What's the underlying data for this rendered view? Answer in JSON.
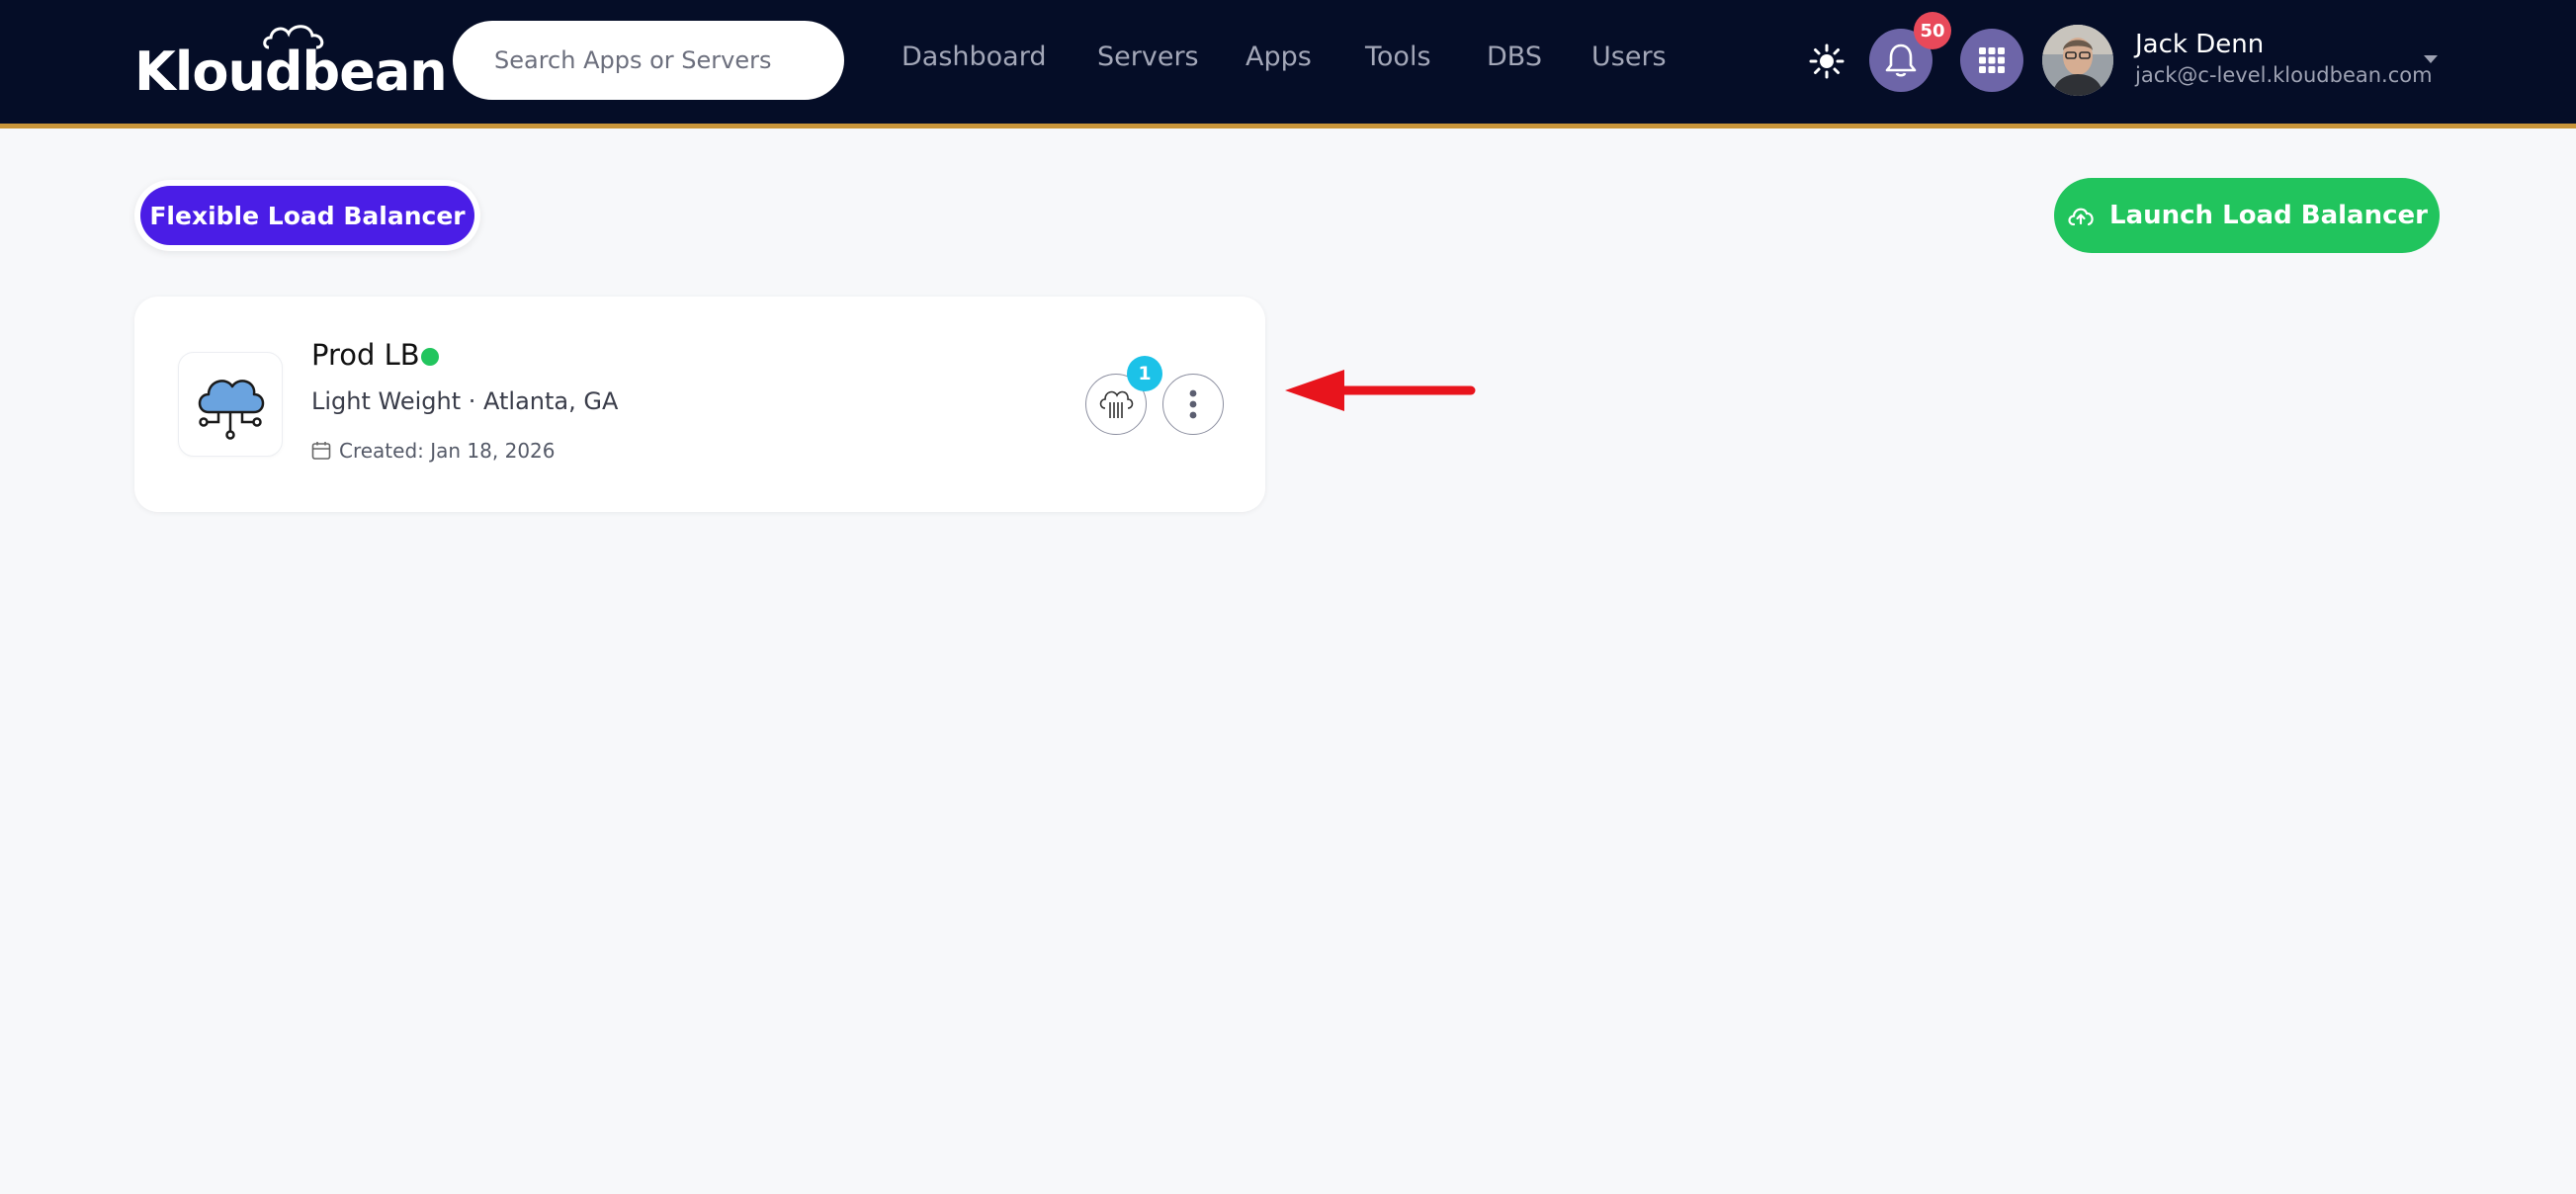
{
  "header": {
    "logo_text": "Kloudbean",
    "search_placeholder": "Search Apps or Servers",
    "nav": [
      {
        "label": "Dashboard"
      },
      {
        "label": "Servers"
      },
      {
        "label": "Apps"
      },
      {
        "label": "Tools"
      },
      {
        "label": "DBS"
      },
      {
        "label": "Users"
      }
    ],
    "notification_count": "50",
    "user": {
      "name": "Jack Denn",
      "email": "jack@c-level.kloudbean.com"
    },
    "icons": [
      "sun-icon",
      "bell-icon",
      "grid-icon",
      "chevron-down-icon"
    ]
  },
  "page": {
    "filter_pill": "Flexible Load Balancer",
    "launch_button": "Launch Load Balancer"
  },
  "load_balancers": [
    {
      "name": "Prod LB",
      "subtitle": "Light Weight · Atlanta, GA",
      "created": "Created: Jan 18, 2026",
      "server_count": "1",
      "status_color": "#22c55e"
    }
  ],
  "colors": {
    "header_bg": "#050d27",
    "accent_purple": "#4a1de6",
    "accent_green": "#21c45d",
    "badge_red": "#e8495a",
    "badge_cyan": "#1cc2e8",
    "annotation_red": "#e8141c"
  }
}
